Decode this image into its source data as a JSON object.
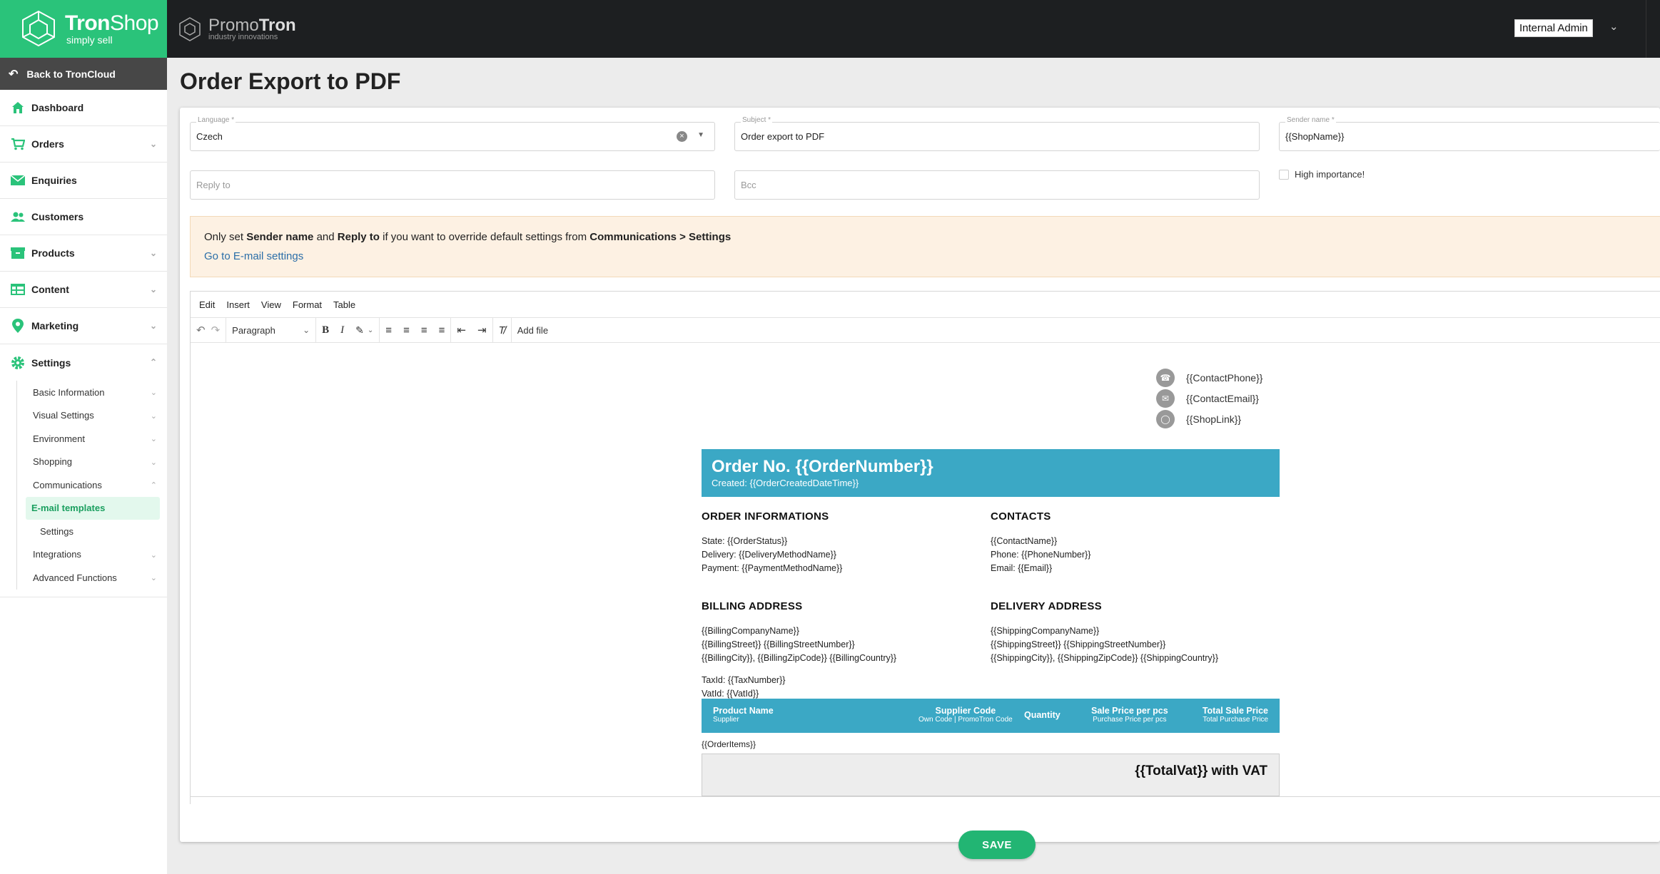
{
  "brand": {
    "name_bold": "Tron",
    "name_rest": "Shop",
    "tagline": "simply sell"
  },
  "partner": {
    "name_light": "Promo",
    "name_bold": "Tron",
    "tagline": "industry innovations"
  },
  "user": {
    "name": "Internal Admin"
  },
  "sidebar": {
    "back_label": "Back to TronCloud",
    "items": [
      {
        "label": "Dashboard",
        "icon": "home-icon"
      },
      {
        "label": "Orders",
        "icon": "cart-icon"
      },
      {
        "label": "Enquiries",
        "icon": "envelope-icon"
      },
      {
        "label": "Customers",
        "icon": "users-icon"
      },
      {
        "label": "Products",
        "icon": "box-icon"
      },
      {
        "label": "Content",
        "icon": "table-icon"
      },
      {
        "label": "Marketing",
        "icon": "pin-icon"
      },
      {
        "label": "Settings",
        "icon": "gear-icon"
      }
    ],
    "settings_sub": [
      "Basic Information",
      "Visual Settings",
      "Environment",
      "Shopping",
      "Communications",
      "E-mail templates",
      "Settings",
      "Integrations",
      "Advanced Functions"
    ]
  },
  "page": {
    "title": "Order Export to PDF"
  },
  "form": {
    "language": {
      "label": "Language *",
      "value": "Czech"
    },
    "subject": {
      "label": "Subject *",
      "value": "Order export to PDF"
    },
    "sender": {
      "label": "Sender name *",
      "value": "{{ShopName}}"
    },
    "reply_to": {
      "placeholder": "Reply to"
    },
    "bcc": {
      "placeholder": "Bcc"
    },
    "high_importance": {
      "label": "High importance!",
      "checked": false
    }
  },
  "notice": {
    "t1": "Only set ",
    "b1": "Sender name",
    "t2": " and ",
    "b2": "Reply to",
    "t3": " if you want to override default settings from ",
    "b3": "Communications > Settings",
    "link": "Go to E-mail settings"
  },
  "editor": {
    "menu": [
      "Edit",
      "Insert",
      "View",
      "Format",
      "Table"
    ],
    "block_format": "Paragraph",
    "add_file": "Add file"
  },
  "email": {
    "contact_phone": "{{ContactPhone}}",
    "contact_email": "{{ContactEmail}}",
    "shop_link": "{{ShopLink}}",
    "order_title": "Order No. {{OrderNumber}}",
    "order_created": "Created: {{OrderCreatedDateTime}}",
    "order_info_title": "ORDER INFORMATIONS",
    "order_info_lines": [
      "State: {{OrderStatus}}",
      "Delivery: {{DeliveryMethodName}}",
      "Payment: {{PaymentMethodName}}"
    ],
    "contacts_title": "CONTACTS",
    "contacts_lines": [
      "{{ContactName}}",
      "Phone: {{PhoneNumber}}",
      "Email: {{Email}}"
    ],
    "billing_title": "BILLING ADDRESS",
    "billing_lines": [
      "{{BillingCompanyName}}",
      "{{BillingStreet}} {{BillingStreetNumber}}",
      "{{BillingCity}}, {{BillingZipCode}} {{BillingCountry}}"
    ],
    "tax_lines": [
      "TaxId: {{TaxNumber}}",
      "VatId: {{VatId}}"
    ],
    "delivery_title": "DELIVERY ADDRESS",
    "delivery_lines": [
      "{{ShippingCompanyName}}",
      "{{ShippingStreet}} {{ShippingStreetNumber}}",
      "{{ShippingCity}}, {{ShippingZipCode}} {{ShippingCountry}}"
    ],
    "items_header": {
      "product": "Product Name",
      "product_sub": "Supplier",
      "supplier_code": "Supplier Code",
      "supplier_code_sub": "Own Code | PromoTron Code",
      "quantity": "Quantity",
      "sale_price": "Sale Price per pcs",
      "sale_price_sub": "Purchase Price per pcs",
      "total_price": "Total Sale Price",
      "total_price_sub": "Total Purchase Price"
    },
    "order_items": "{{OrderItems}}",
    "total_vat": "{{TotalVat}} with VAT"
  },
  "actions": {
    "save_label": "SAVE"
  },
  "colors": {
    "brand_green": "#2ac37a",
    "header_blue": "#3ba8c5",
    "save_green": "#22b573"
  }
}
